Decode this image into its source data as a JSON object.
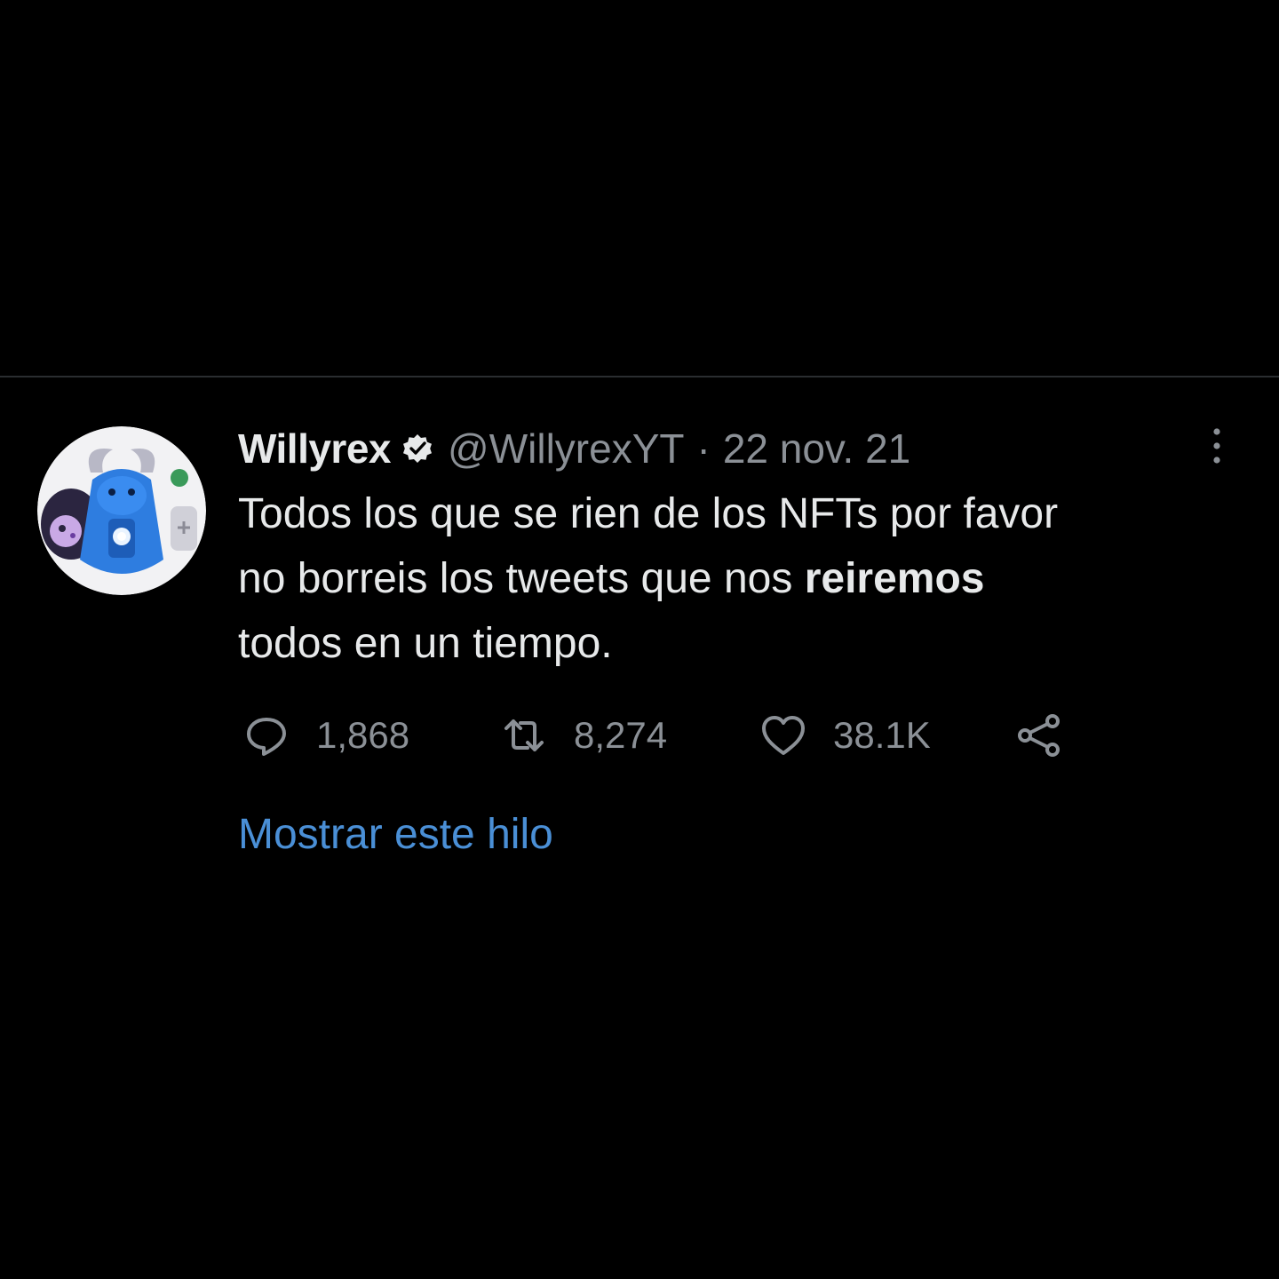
{
  "tweet": {
    "display_name": "Willyrex",
    "verified_icon": "verified-badge-icon",
    "handle": "@WillyrexYT",
    "separator": "·",
    "date": "22 nov. 21",
    "text": {
      "line1": "Todos los que se rien de los NFTs por favor",
      "line2_prefix": "no borreis los tweets que nos ",
      "line2_bold": "reiremos",
      "line3": "todos en un tiempo."
    },
    "actions": {
      "replies": "1,868",
      "retweets": "8,274",
      "likes": "38.1K"
    },
    "show_thread": "Mostrar este hilo"
  },
  "icons": {
    "reply": "reply-icon",
    "retweet": "retweet-icon",
    "like": "heart-icon",
    "share": "share-icon",
    "more": "more-vertical-icon"
  },
  "colors": {
    "background": "#000000",
    "text": "#e7e9ea",
    "secondary_text": "#8b9096",
    "link": "#4a8fd6"
  }
}
